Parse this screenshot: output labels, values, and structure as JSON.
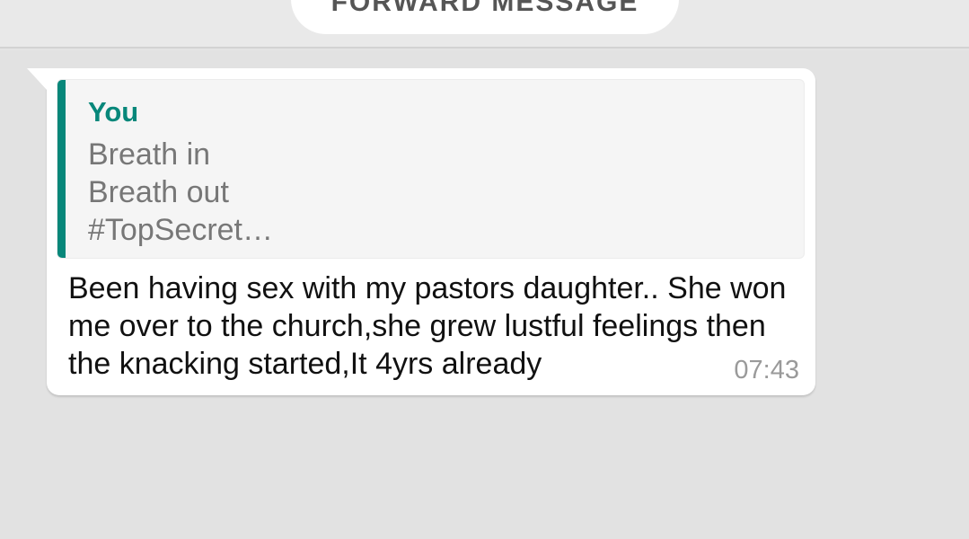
{
  "header": {
    "pill_label": "FORWARD MESSAGE"
  },
  "message": {
    "quoted": {
      "author": "You",
      "text": "Breath in\nBreath out\n#TopSecret…"
    },
    "body": "Been having sex with my pastors daughter.. She won me over to the church,she grew lustful feelings then the knacking started,It 4yrs already",
    "time": "07:43"
  },
  "colors": {
    "accent": "#07877a",
    "background": "#e2e2e2",
    "bubble": "#ffffff"
  }
}
